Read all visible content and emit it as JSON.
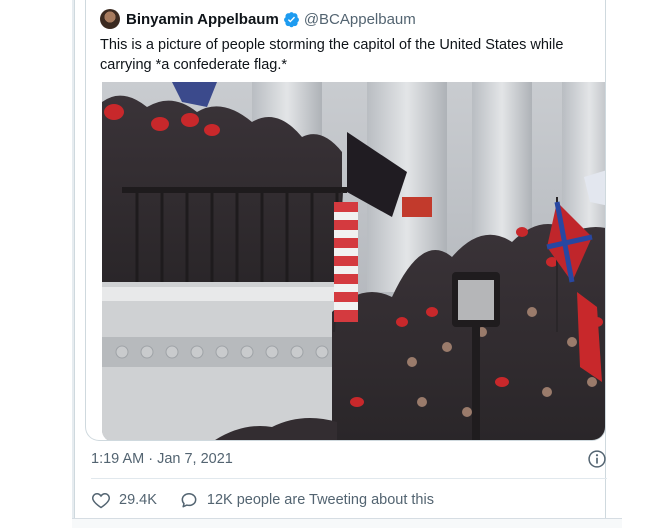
{
  "quoted_tweet": {
    "author_name": "Binyamin Appelbaum",
    "author_handle": "@BCAppelbaum",
    "text": "This is a picture of people storming the capitol of the United States while carrying *a confederate flag.*",
    "media_icon": "photo-crowd-capitol"
  },
  "meta": {
    "timestamp": "1:19 AM · Jan 7, 2021"
  },
  "actions": {
    "like_count": "29.4K",
    "reply_label": "12K people are Tweeting about this"
  },
  "colors": {
    "verified": "#1d9bf0",
    "secondary_text": "#536471",
    "primary_text": "#0f1419",
    "border": "#cfd9de"
  },
  "icons": {
    "verified": "verified-badge-icon",
    "info": "info-icon",
    "like": "heart-icon",
    "reply": "speech-bubble-icon"
  }
}
